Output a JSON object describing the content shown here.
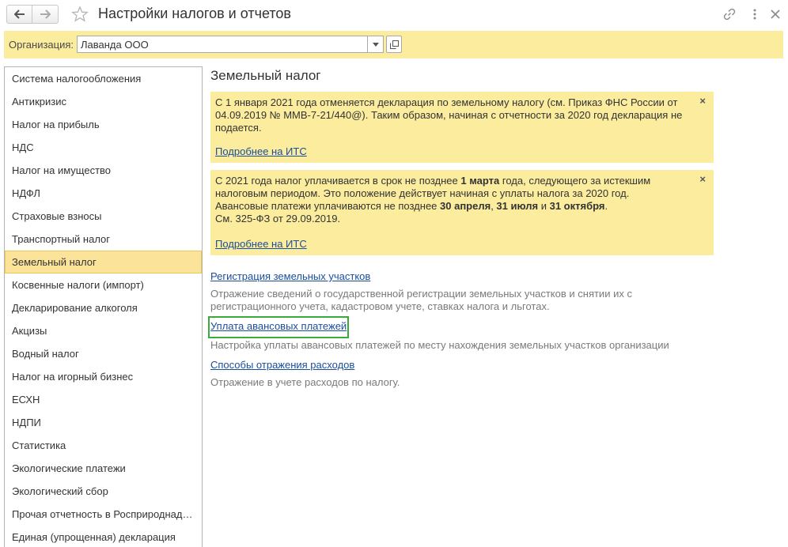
{
  "window": {
    "title": "Настройки налогов и отчетов"
  },
  "org_bar": {
    "label": "Организация:",
    "value": "Лаванда ООО"
  },
  "sidebar": {
    "items": [
      {
        "label": "Система налогообложения"
      },
      {
        "label": "Антикризис"
      },
      {
        "label": "Налог на прибыль"
      },
      {
        "label": "НДС"
      },
      {
        "label": "Налог на имущество"
      },
      {
        "label": "НДФЛ"
      },
      {
        "label": "Страховые взносы"
      },
      {
        "label": "Транспортный налог"
      },
      {
        "label": "Земельный налог",
        "active": true
      },
      {
        "label": "Косвенные налоги (импорт)"
      },
      {
        "label": "Декларирование алкоголя"
      },
      {
        "label": "Акцизы"
      },
      {
        "label": "Водный налог"
      },
      {
        "label": "Налог на игорный бизнес"
      },
      {
        "label": "ЕСХН"
      },
      {
        "label": "НДПИ"
      },
      {
        "label": "Статистика"
      },
      {
        "label": "Экологические платежи"
      },
      {
        "label": "Экологический сбор"
      },
      {
        "label": "Прочая отчетность в Росприроднад…"
      },
      {
        "label": "Единая (упрощенная) декларация"
      }
    ]
  },
  "main": {
    "title": "Земельный налог",
    "notice1": {
      "text": "С 1 января 2021 года отменяется декларация по земельному налогу (см. Приказ ФНС России от 04.09.2019 № ММВ-7-21/440@). Таким образом, начиная с отчетности за 2020 год декларация не подается.",
      "link": "Подробнее на ИТС",
      "close": "×"
    },
    "notice2": {
      "t1": "С 2021 года налог уплачивается в срок не позднее ",
      "b1": "1 марта",
      "t2": " года, следующего за истекшим налоговым периодом. Это положение действует начиная с уплаты налога за 2020 год.",
      "t3": "Авансовые платежи уплачиваются не позднее ",
      "b2": "30 апреля",
      "t4": ", ",
      "b3": "31 июля",
      "t5": " и ",
      "b4": "31 октября",
      "t6": ".",
      "t7": "См. 325-ФЗ от 29.09.2019.",
      "link": "Подробнее на ИТС",
      "close": "×"
    },
    "sections": [
      {
        "link": "Регистрация земельных участков",
        "desc": "Отражение сведений о государственной регистрации земельных участков и снятии их с регистрационного учета, кадастровом учете, ставках налога и льготах."
      },
      {
        "link": "Уплата авансовых платежей",
        "desc": "Настройка уплаты авансовых платежей по месту нахождения земельных участков организации"
      },
      {
        "link": "Способы отражения расходов",
        "desc": "Отражение в учете расходов по налогу."
      }
    ]
  },
  "colors": {
    "yellow_panel": "#fbec9e",
    "active_item": "#fbe49a",
    "link": "#1a4d9c",
    "highlight": "#3aaa3a"
  }
}
